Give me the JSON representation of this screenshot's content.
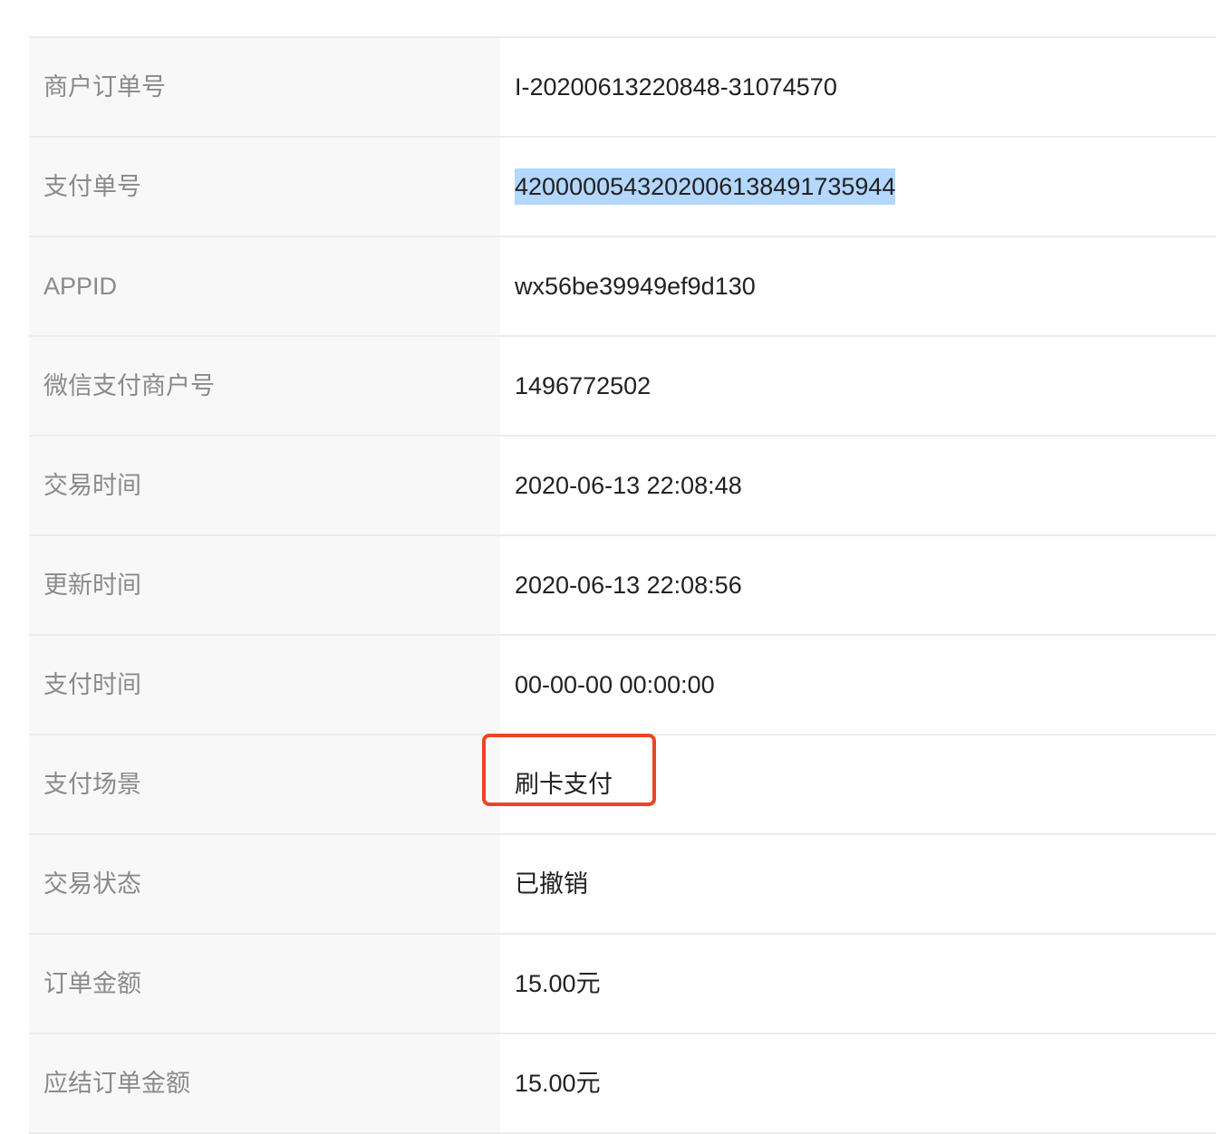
{
  "details": [
    {
      "key": "merchant_order_no",
      "label": "商户订单号",
      "value": "I-20200613220848-31074570"
    },
    {
      "key": "payment_no",
      "label": "支付单号",
      "value": "4200000543202006138491735944",
      "selected": true
    },
    {
      "key": "appid",
      "label": "APPID",
      "value": "wx56be39949ef9d130"
    },
    {
      "key": "wechat_merchant_no",
      "label": "微信支付商户号",
      "value": "1496772502"
    },
    {
      "key": "trade_time",
      "label": "交易时间",
      "value": "2020-06-13 22:08:48"
    },
    {
      "key": "update_time",
      "label": "更新时间",
      "value": "2020-06-13 22:08:56"
    },
    {
      "key": "pay_time",
      "label": "支付时间",
      "value": "00-00-00 00:00:00"
    },
    {
      "key": "pay_scene",
      "label": "支付场景",
      "value": "刷卡支付",
      "highlighted": true
    },
    {
      "key": "trade_status",
      "label": "交易状态",
      "value": "已撤销"
    },
    {
      "key": "order_amount",
      "label": "订单金额",
      "value": "15.00元"
    },
    {
      "key": "settle_amount",
      "label": "应结订单金额",
      "value": "15.00元"
    }
  ],
  "colors": {
    "label_bg": "#f8f8f8",
    "label_text": "#8a8a8a",
    "value_text": "#222222",
    "divider": "#ececec",
    "selection": "#b3d7ff",
    "highlight_box": "#ee4422"
  }
}
